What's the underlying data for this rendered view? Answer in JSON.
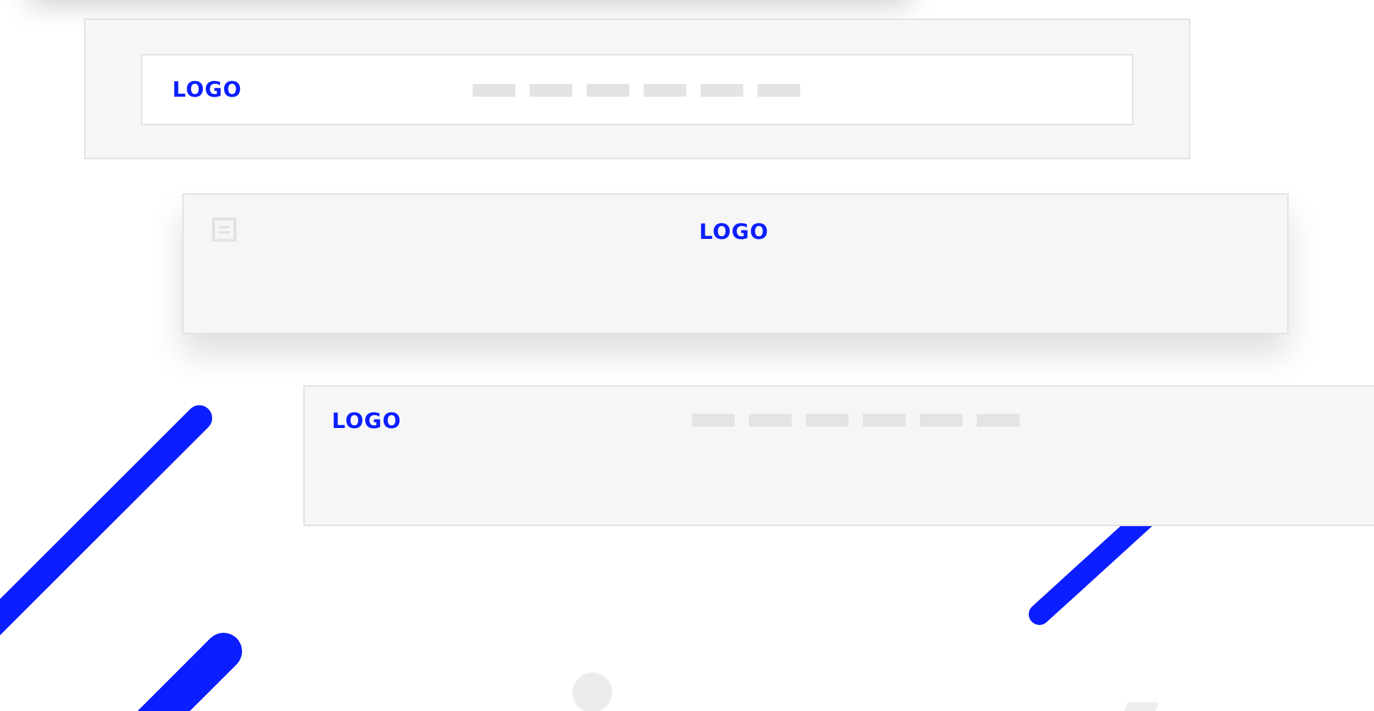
{
  "headers": [
    {
      "kind": "framed",
      "logo": "LOGO",
      "menu": [
        {
          "kind": "bar"
        },
        {
          "kind": "bar"
        },
        {
          "kind": "bar"
        },
        {
          "kind": "bar"
        },
        {
          "kind": "bar"
        },
        {
          "kind": "bar"
        }
      ]
    },
    {
      "kind": "centered",
      "logo": "LOGO"
    },
    {
      "kind": "plain",
      "logo": "LOGO",
      "menu": [
        {
          "kind": "bar"
        },
        {
          "kind": "bar"
        },
        {
          "kind": "bar"
        },
        {
          "kind": "bar"
        },
        {
          "kind": "bar"
        },
        {
          "kind": "bar"
        }
      ]
    }
  ]
}
